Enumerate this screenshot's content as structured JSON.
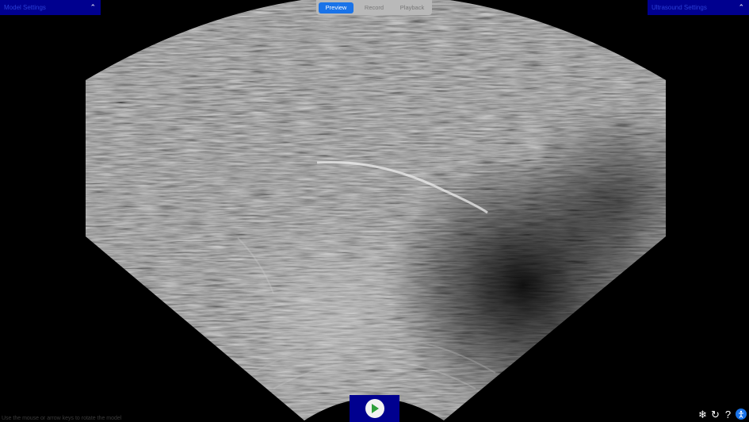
{
  "panels": {
    "left_title": "Model Settings",
    "right_title": "Ultrasound Settings"
  },
  "tabs": [
    {
      "label": "Preview",
      "active": true
    },
    {
      "label": "Record",
      "active": false
    },
    {
      "label": "Playback",
      "active": false
    }
  ],
  "hint": "Use the mouse or arrow keys to rotate the model",
  "controls": {
    "play_icon": "play-icon",
    "icons": [
      "snowflake-icon",
      "refresh-icon",
      "help-icon",
      "accessibility-icon"
    ]
  },
  "colors": {
    "panel_bg": "#00008f",
    "tab_active": "#1a73e8",
    "tab_bar": "#b9b9b9",
    "background": "#000000"
  }
}
